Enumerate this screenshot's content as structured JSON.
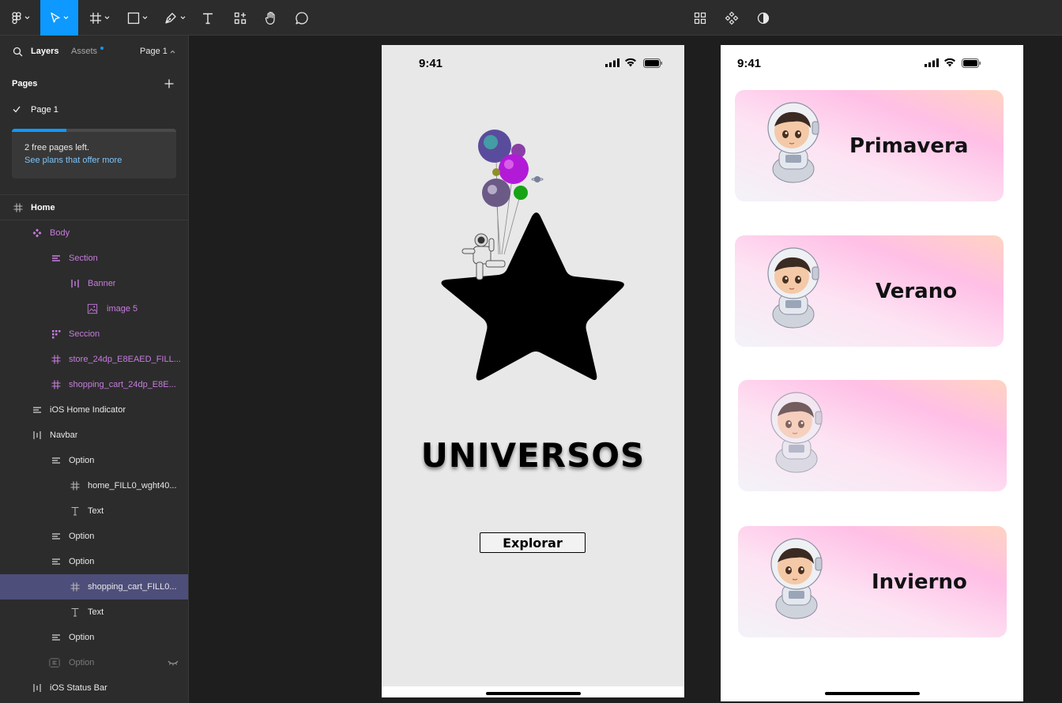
{
  "toolbar": {
    "center_icons": [
      "grid-icon",
      "components-icon",
      "contrast-icon"
    ]
  },
  "panel": {
    "tab_layers": "Layers",
    "tab_assets": "Assets",
    "page_selector": "Page 1",
    "pages_title": "Pages",
    "page_item": "Page 1",
    "promo_line1": "2 free pages left.",
    "promo_line2": "See plans that offer more",
    "promo_progress_fraction": 0.33
  },
  "layers": [
    {
      "label": "Home",
      "icon": "frame-icon"
    },
    {
      "label": "Body",
      "icon": "component-instance-icon"
    },
    {
      "label": "Section",
      "icon": "auto-layout-vertical-icon"
    },
    {
      "label": "Banner",
      "icon": "auto-layout-horizontal-icon"
    },
    {
      "label": "image 5",
      "icon": "image-icon"
    },
    {
      "label": "Seccion",
      "icon": "grid-layout-icon"
    },
    {
      "label": "store_24dp_E8EAED_FILL...",
      "icon": "frame-icon"
    },
    {
      "label": "shopping_cart_24dp_E8E...",
      "icon": "frame-icon"
    },
    {
      "label": "iOS Home Indicator",
      "icon": "auto-layout-vertical-icon"
    },
    {
      "label": "Navbar",
      "icon": "auto-layout-horizontal-icon"
    },
    {
      "label": "Option",
      "icon": "auto-layout-vertical-icon"
    },
    {
      "label": "home_FILL0_wght40...",
      "icon": "frame-icon"
    },
    {
      "label": "Text",
      "icon": "text-icon"
    },
    {
      "label": "Option",
      "icon": "auto-layout-vertical-icon"
    },
    {
      "label": "Option",
      "icon": "auto-layout-vertical-icon"
    },
    {
      "label": "shopping_cart_FILL0...",
      "icon": "frame-icon"
    },
    {
      "label": "Text",
      "icon": "text-icon"
    },
    {
      "label": "Option",
      "icon": "auto-layout-vertical-icon"
    },
    {
      "label": "Option",
      "icon": "hidden-frame-icon"
    },
    {
      "label": "iOS Status Bar",
      "icon": "auto-layout-horizontal-icon"
    }
  ],
  "frame1": {
    "time": "9:41",
    "title": "UNIVERSOS",
    "button": "Explorar"
  },
  "frame2": {
    "time": "9:41",
    "cards": [
      "Primavera",
      "Verano",
      "",
      "Invierno"
    ]
  }
}
